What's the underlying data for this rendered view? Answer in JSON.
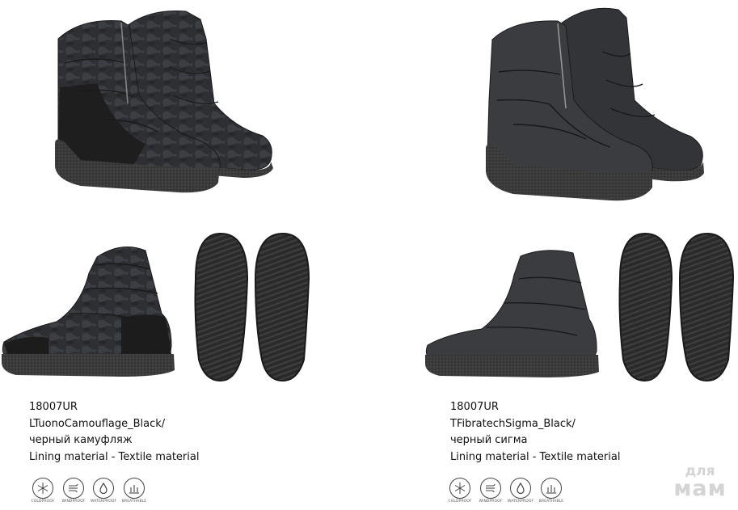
{
  "products": [
    {
      "code": "18007UR",
      "material": "LTuonoCamouflage_Black/",
      "color_ru": "черный камуфляж",
      "lining": "Lining material - Textile material"
    },
    {
      "code": "18007UR",
      "material": "TFibratechSigma_Black/",
      "color_ru": "черный сигма",
      "lining": "Lining material - Textile material"
    }
  ],
  "feature_icons": [
    {
      "icon": "snowflake-icon",
      "label": "COLDPROOF"
    },
    {
      "icon": "wind-icon",
      "label": "WINDPROOF"
    },
    {
      "icon": "water-drop-icon",
      "label": "WATERPROOF"
    },
    {
      "icon": "breathable-icon",
      "label": "BREATHABLE"
    }
  ],
  "watermark": {
    "line1": "для",
    "line2": "мам"
  }
}
